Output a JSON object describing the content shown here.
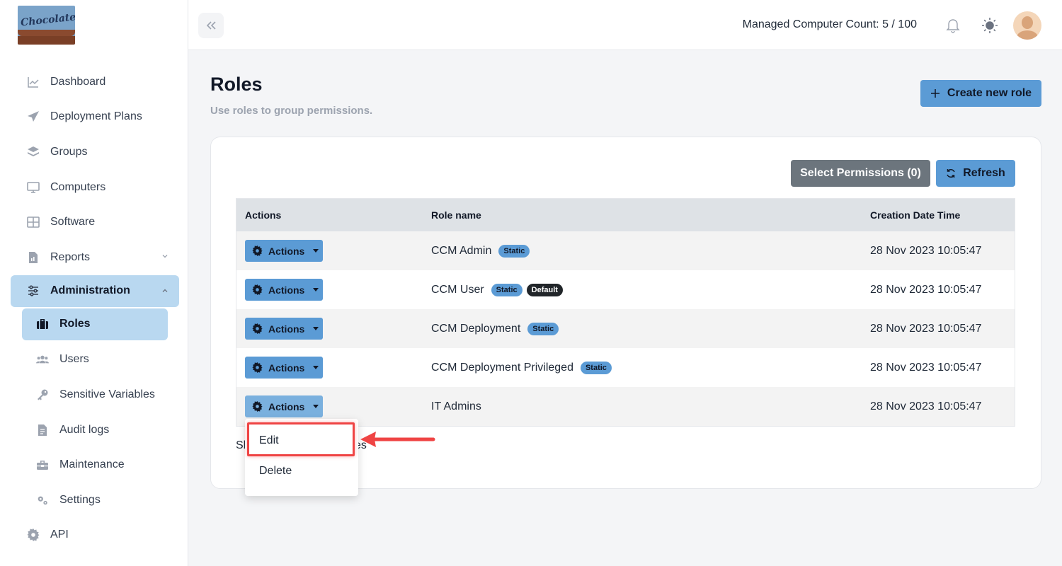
{
  "brand": {
    "logo_text": "Chocolatey"
  },
  "sidebar": {
    "items": [
      {
        "label": "Dashboard",
        "icon": "chart-line-icon"
      },
      {
        "label": "Deployment Plans",
        "icon": "paper-plane-icon"
      },
      {
        "label": "Groups",
        "icon": "layers-icon"
      },
      {
        "label": "Computers",
        "icon": "monitor-icon"
      },
      {
        "label": "Software",
        "icon": "grid-icon"
      },
      {
        "label": "Reports",
        "icon": "report-icon"
      },
      {
        "label": "Administration",
        "icon": "sliders-icon"
      }
    ],
    "admin_sub": [
      {
        "label": "Roles",
        "icon": "briefcase-icon"
      },
      {
        "label": "Users",
        "icon": "users-icon"
      },
      {
        "label": "Sensitive Variables",
        "icon": "key-icon"
      },
      {
        "label": "Audit logs",
        "icon": "document-icon"
      },
      {
        "label": "Maintenance",
        "icon": "toolbox-icon"
      },
      {
        "label": "Settings",
        "icon": "gears-icon"
      }
    ],
    "api": {
      "label": "API",
      "icon": "gear-icon"
    }
  },
  "topbar": {
    "managed_count": "Managed Computer Count: 5 / 100"
  },
  "page": {
    "title": "Roles",
    "subtitle": "Use roles to group permissions.",
    "create_label": "Create new role"
  },
  "toolbar": {
    "select_permissions": "Select Permissions (0)",
    "refresh": "Refresh"
  },
  "table": {
    "headers": [
      "Actions",
      "Role name",
      "Creation Date Time"
    ],
    "action_label": "Actions",
    "rows": [
      {
        "name": "CCM Admin",
        "badges": [
          "Static"
        ],
        "date": "28 Nov 2023 10:05:47"
      },
      {
        "name": "CCM User",
        "badges": [
          "Static",
          "Default"
        ],
        "date": "28 Nov 2023 10:05:47"
      },
      {
        "name": "CCM Deployment",
        "badges": [
          "Static"
        ],
        "date": "28 Nov 2023 10:05:47"
      },
      {
        "name": "CCM Deployment Privileged",
        "badges": [
          "Static"
        ],
        "date": "28 Nov 2023 10:05:47"
      },
      {
        "name": "IT Admins",
        "badges": [],
        "date": "28 Nov 2023 10:05:47"
      }
    ]
  },
  "footer": {
    "showing_partial_left": "Sh",
    "showing_partial_right": "es"
  },
  "dropdown": {
    "items": [
      "Edit",
      "Delete"
    ]
  },
  "colors": {
    "accent": "#5b9bd5",
    "active_nav": "#b9d8f0",
    "highlight": "#ef4444"
  }
}
